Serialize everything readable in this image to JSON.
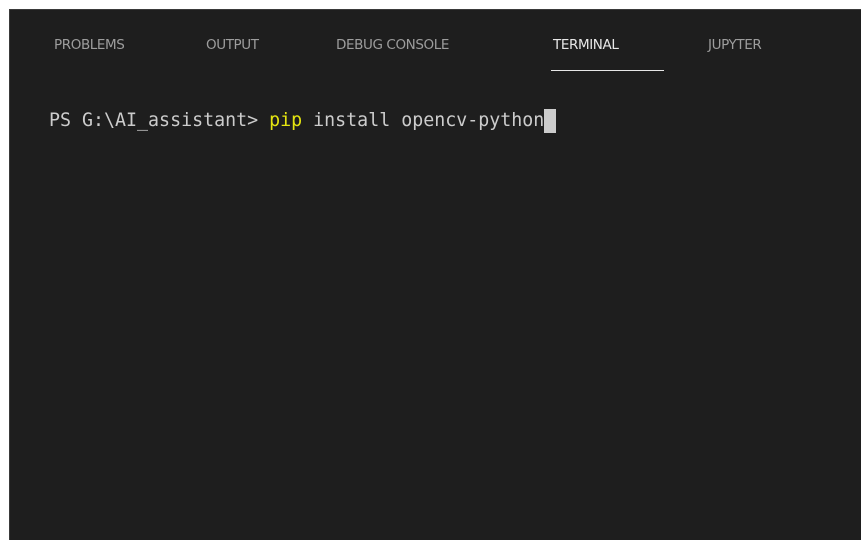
{
  "panel": {
    "tabs": [
      {
        "label": "PROBLEMS"
      },
      {
        "label": "OUTPUT"
      },
      {
        "label": "DEBUG CONSOLE"
      },
      {
        "label": "TERMINAL",
        "active": true
      },
      {
        "label": "JUPYTER"
      }
    ]
  },
  "terminal": {
    "prompt": "PS G:\\AI_assistant> ",
    "command": "pip",
    "args": " install opencv-python",
    "colors": {
      "background": "#1e1e1e",
      "text": "#cccccc",
      "command": "#e5e510",
      "active_tab": "#e7e7e7",
      "inactive_tab": "#9d9d9d"
    }
  }
}
